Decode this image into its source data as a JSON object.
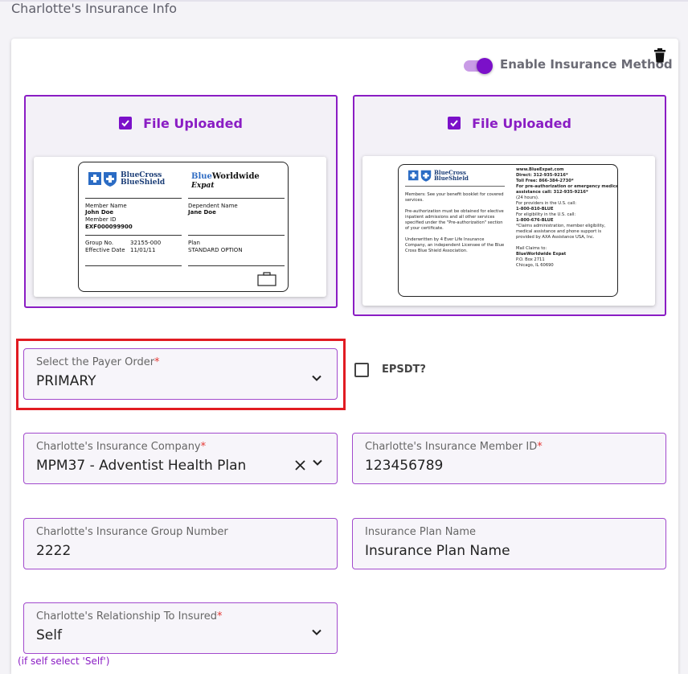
{
  "page": {
    "title": "Charlotte's Insurance Info"
  },
  "insurance_toggle": {
    "label": "Enable Insurance Method",
    "enabled": true
  },
  "uploads": [
    {
      "status": "File Uploaded",
      "card": {
        "logo_line1": "BlueCross",
        "logo_line2": "BlueShield",
        "brand_blue": "Blue",
        "brand_rest": "Worldwide",
        "brand_sub": "Expat",
        "member_name_label": "Member Name",
        "member_name": "John Doe",
        "member_id_label": "Member ID",
        "member_id": "EXF000099900",
        "dependent_label": "Dependent Name",
        "dependent_name": "Jane Doe",
        "group_label": "Group No.",
        "group_value": "32155-000",
        "effective_label": "Effective Date",
        "effective_value": "11/01/11",
        "plan_label": "Plan",
        "plan_value": "STANDARD OPTION"
      }
    },
    {
      "status": "File Uploaded",
      "card": {
        "logo_line1": "BlueCross",
        "logo_line2": "BlueShield",
        "left_text": [
          "Members: See your benefit booklet for covered",
          "services.",
          "",
          "Pre-authorization must be obtained for elective",
          "inpatient admissions and all other services",
          "specified under the \"Pre-authorization\" section",
          "of your certificate.",
          "",
          "Underwritten by 4 Ever Life Insurance",
          "Company, an independent Licensee of the Blue",
          "Cross Blue Shield Association."
        ],
        "right_text": [
          "www.BlueExpat.com",
          "Direct: 312-935-9216*",
          "Toll Free: 866-384-2730*",
          "For pre-authorization or emergency medical",
          "assistance call: 312-935-9216*",
          "(24 hours).",
          "For providers in the U.S. call:",
          "1-800-810-BLUE",
          "For eligibility in the U.S. call:",
          "1-800-676-BLUE",
          "*Claims administration, member eligibility,",
          "medical assistance and phone support is",
          "provided by AXA Assistance USA, Inc.",
          "",
          "Mail Claims to:",
          "BlueWorldwide Expat",
          "P.O. Box 2711",
          "Chicago, IL 60690"
        ]
      }
    }
  ],
  "payer_order": {
    "label": "Select the Payer Order",
    "required_mark": "*",
    "value": "PRIMARY"
  },
  "epsdt": {
    "label": "EPSDT?",
    "checked": false
  },
  "insurance_company": {
    "label": "Charlotte's Insurance Company",
    "required_mark": "*",
    "value": "MPM37 -  Adventist Health Plan"
  },
  "member_id": {
    "label": "Charlotte's Insurance Member ID",
    "required_mark": "*",
    "value": "123456789"
  },
  "group_number": {
    "label": "Charlotte's Insurance Group Number",
    "value": "2222"
  },
  "plan_name": {
    "label": "Insurance Plan Name",
    "value": "Insurance Plan Name"
  },
  "relationship": {
    "label": "Charlotte's Relationship To Insured",
    "required_mark": "*",
    "value": "Self",
    "hint": "(if self select 'Self')"
  },
  "colors": {
    "accent": "#7b10c9",
    "border": "#a24acd",
    "highlight": "#e11b22",
    "required": "#e53935"
  }
}
